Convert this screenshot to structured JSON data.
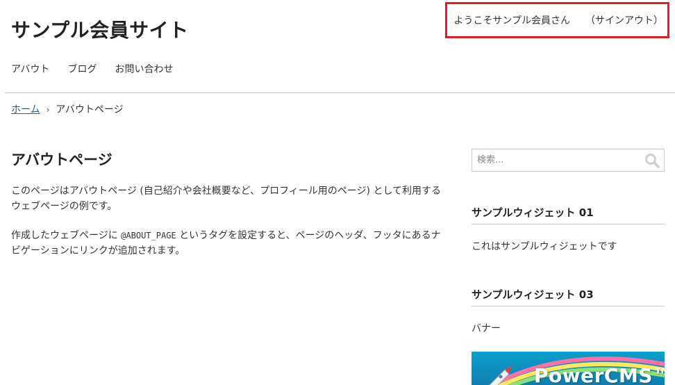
{
  "header": {
    "site_title": "サンプル会員サイト",
    "welcome_text": "ようこそサンプル会員さん",
    "signout_label": "（サインアウト）"
  },
  "nav": {
    "items": [
      {
        "label": "アバウト"
      },
      {
        "label": "ブログ"
      },
      {
        "label": "お問い合わせ"
      }
    ]
  },
  "breadcrumb": {
    "home_label": "ホーム",
    "separator": "›",
    "current_label": "アバウトページ"
  },
  "main": {
    "title": "アバウトページ",
    "paragraph1": "このページはアバウトページ (自己紹介や会社概要など、プロフィール用のページ) として利用するウェブページの例です。",
    "paragraph2_before": "作成したウェブページに ",
    "paragraph2_code": "@ABOUT_PAGE",
    "paragraph2_after": " というタグを設定すると、ページのヘッダ、フッタにあるナビゲーションにリンクが追加されます。"
  },
  "sidebar": {
    "search": {
      "placeholder": "検索...",
      "icon": "search-icon"
    },
    "widget1": {
      "title": "サンプルウィジェット 01",
      "text": "これはサンプルウィジェットです"
    },
    "widget3": {
      "title": "サンプルウィジェット 03",
      "text": "バナー"
    },
    "banner": {
      "text": "PowerCMS™"
    }
  },
  "colors": {
    "highlight_border": "#e02020",
    "link": "#2a5d86",
    "banner_blue": "#0f86b8"
  }
}
